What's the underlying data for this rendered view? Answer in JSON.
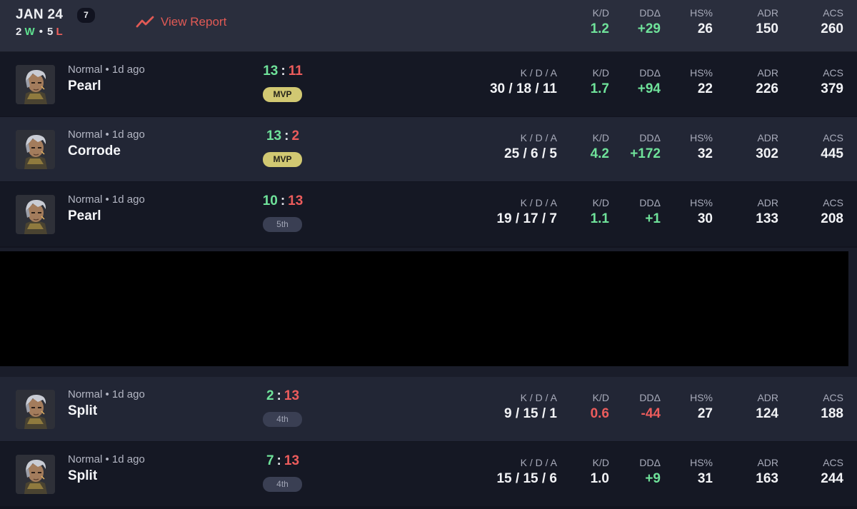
{
  "header": {
    "date": "JAN 24",
    "match_count": "7",
    "wins": "2",
    "wins_letter": "W",
    "losses": "5",
    "losses_letter": "L",
    "view_report": "View Report",
    "stats": [
      {
        "label": "K/D",
        "value": "1.2",
        "tone": "green"
      },
      {
        "label": "DDΔ",
        "value": "+29",
        "tone": "green"
      },
      {
        "label": "HS%",
        "value": "26",
        "tone": ""
      },
      {
        "label": "ADR",
        "value": "150",
        "tone": ""
      },
      {
        "label": "ACS",
        "value": "260",
        "tone": ""
      }
    ]
  },
  "kda_label": "K / D / A",
  "matches": [
    {
      "mode": "Normal • 1d ago",
      "map": "Pearl",
      "score_us": "13",
      "score_them": "11",
      "badge": "MVP",
      "badge_type": "mvp",
      "kda": "30 / 18 / 11",
      "kd": "1.7",
      "kd_tone": "green",
      "dd": "+94",
      "dd_tone": "green",
      "hs": "22",
      "adr": "226",
      "acs": "379"
    },
    {
      "mode": "Normal • 1d ago",
      "map": "Corrode",
      "score_us": "13",
      "score_them": "2",
      "badge": "MVP",
      "badge_type": "mvp",
      "kda": "25 / 6 / 5",
      "kd": "4.2",
      "kd_tone": "green",
      "dd": "+172",
      "dd_tone": "green",
      "hs": "32",
      "adr": "302",
      "acs": "445"
    },
    {
      "mode": "Normal • 1d ago",
      "map": "Pearl",
      "score_us": "10",
      "score_them": "13",
      "badge": "5th",
      "badge_type": "place",
      "kda": "19 / 17 / 7",
      "kd": "1.1",
      "kd_tone": "green",
      "dd": "+1",
      "dd_tone": "green",
      "hs": "30",
      "adr": "133",
      "acs": "208"
    },
    {
      "mode": "Normal • 1d ago",
      "map": "Split",
      "score_us": "2",
      "score_them": "13",
      "badge": "4th",
      "badge_type": "place",
      "kda": "9 / 15 / 1",
      "kd": "0.6",
      "kd_tone": "red",
      "dd": "-44",
      "dd_tone": "red",
      "hs": "27",
      "adr": "124",
      "acs": "188"
    },
    {
      "mode": "Normal • 1d ago",
      "map": "Split",
      "score_us": "7",
      "score_them": "13",
      "badge": "4th",
      "badge_type": "place",
      "kda": "15 / 15 / 6",
      "kd": "1.0",
      "kd_tone": "",
      "dd": "+9",
      "dd_tone": "green",
      "hs": "31",
      "adr": "163",
      "acs": "244"
    }
  ],
  "stat_labels": {
    "kd": "K/D",
    "dd": "DDΔ",
    "hs": "HS%",
    "adr": "ADR",
    "acs": "ACS"
  },
  "icons": {
    "report": "trend-line-icon",
    "avatar": "agent-portrait-icon"
  },
  "colors": {
    "win": "#6fe29a",
    "loss": "#ec5c5c",
    "mvp": "#d1c872",
    "report": "#e15a55"
  }
}
